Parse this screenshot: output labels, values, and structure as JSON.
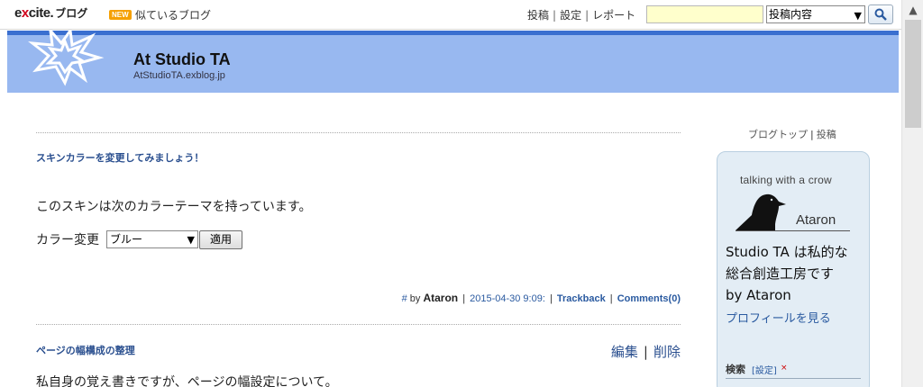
{
  "topbar": {
    "logo_prefix": "e",
    "logo_mid": "x",
    "logo_rest": "cite.",
    "logo_blog": "ブログ",
    "new_badge": "NEW",
    "similar_blogs": "似ているブログ",
    "links": [
      "投稿",
      "設定",
      "レポート"
    ],
    "link_sep": "|",
    "search_value": "",
    "search_scope": "投稿内容"
  },
  "header": {
    "title": "At Studio TA",
    "url": "AtStudioTA.exblog.jp"
  },
  "posts": [
    {
      "title": "スキンカラーを変更してみましょう！",
      "body_line1": "このスキンは次のカラーテーマを持っています。",
      "color_label": "カラー変更",
      "color_value": "ブルー",
      "apply_label": "適用",
      "meta_hash": "#",
      "meta_by": "by",
      "meta_author": "Ataron",
      "meta_date": "2015-04-30 9:09:",
      "meta_trackback": "Trackback",
      "meta_comments": "Comments(0)"
    },
    {
      "title": "ページの幅構成の整理",
      "edit": "編集",
      "delete": "削除",
      "body_line1": "私自身の覚え書きですが、ページの幅設定について。"
    }
  ],
  "sidebar": {
    "blog_top": "ブログトップ",
    "post": "投稿",
    "card_tagline": "talking with a crow",
    "card_name": "Ataron",
    "profile_line1": "Studio TA は私的な",
    "profile_line2": "総合創造工房です",
    "profile_line3": "by Ataron",
    "profile_link": "プロフィールを見る",
    "search_label": "検索",
    "search_setting": "[設定]",
    "search_close": "×"
  },
  "colors": {
    "header_band": "#98b8f0",
    "header_border": "#3a6fd0",
    "link_blue": "#2a5aa0",
    "sidebar_bg": "#e3edf5"
  }
}
